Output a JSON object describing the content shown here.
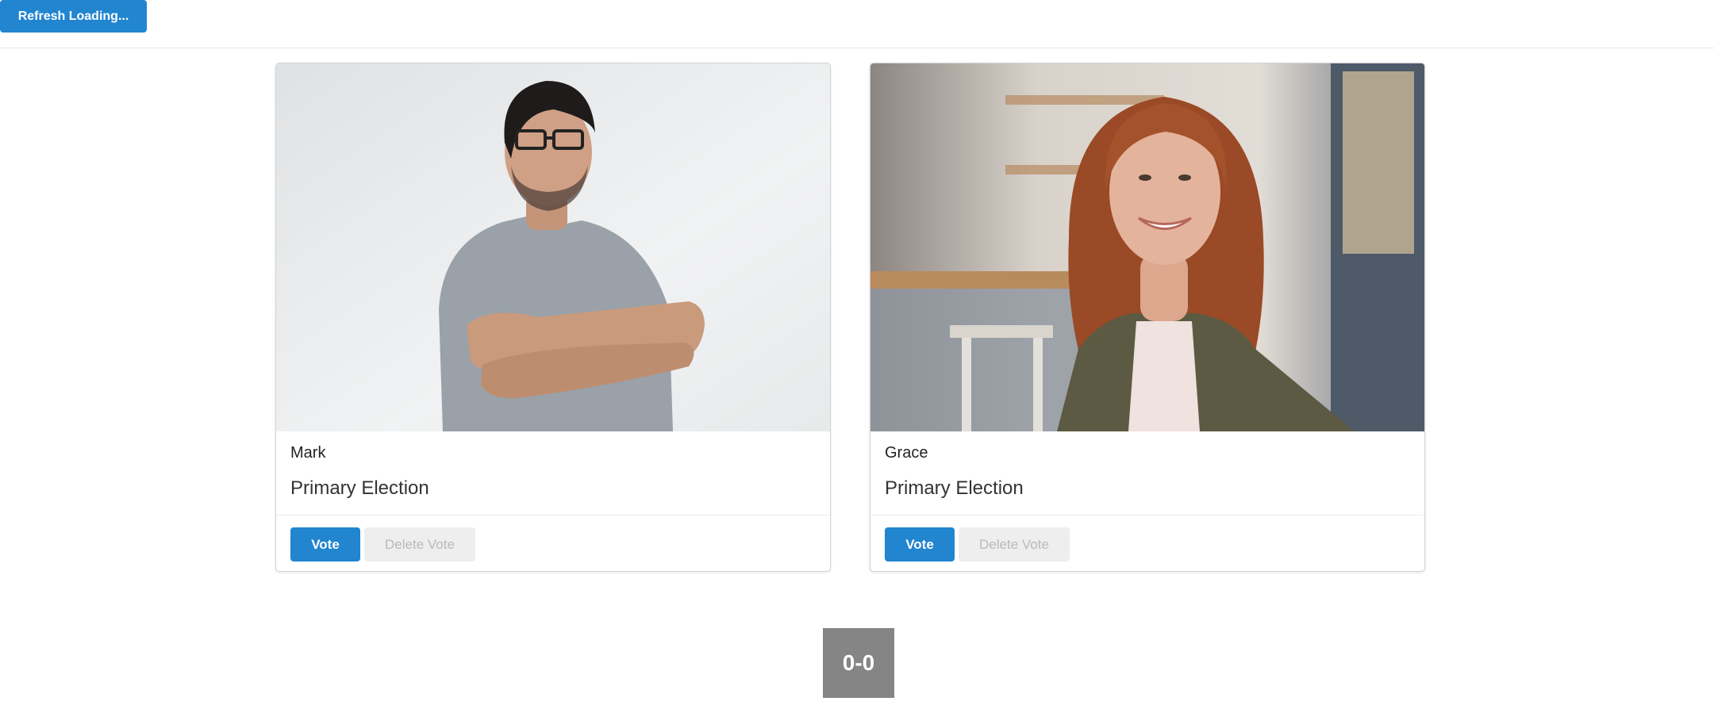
{
  "topbar": {
    "refresh_label": "Refresh Loading..."
  },
  "candidates": [
    {
      "name": "Mark",
      "election": "Primary Election",
      "vote_label": "Vote",
      "delete_label": "Delete Vote"
    },
    {
      "name": "Grace",
      "election": "Primary Election",
      "vote_label": "Vote",
      "delete_label": "Delete Vote"
    }
  ],
  "score": {
    "text": "0-0"
  },
  "colors": {
    "primary": "#2185d0",
    "disabled_bg": "#eeeeee",
    "score_bg": "#858585"
  }
}
